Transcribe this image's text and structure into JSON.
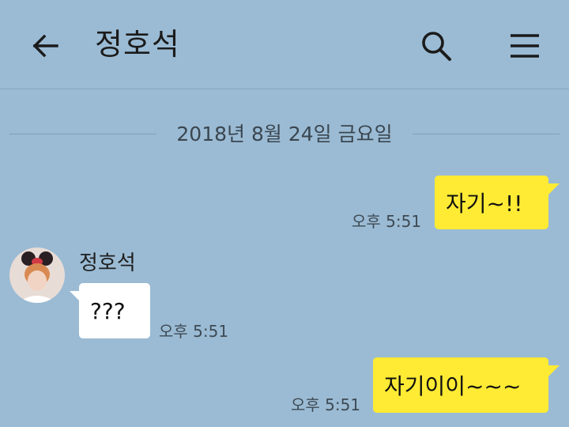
{
  "header": {
    "title": "정호석",
    "icons": {
      "back": "arrow-left-icon",
      "search": "search-icon",
      "menu": "menu-icon"
    }
  },
  "date_divider": "2018년 8월 24일 금요일",
  "messages": [
    {
      "from": "me",
      "text": "자기~!!",
      "time": "오후 5:51"
    },
    {
      "from": "them",
      "sender": "정호석",
      "text": "???",
      "time": "오후 5:51"
    },
    {
      "from": "me",
      "text": "자기이이~~~",
      "time": "오후 5:51"
    }
  ],
  "colors": {
    "background": "#9bbbd4",
    "my_bubble": "#ffeb33",
    "their_bubble": "#ffffff"
  }
}
